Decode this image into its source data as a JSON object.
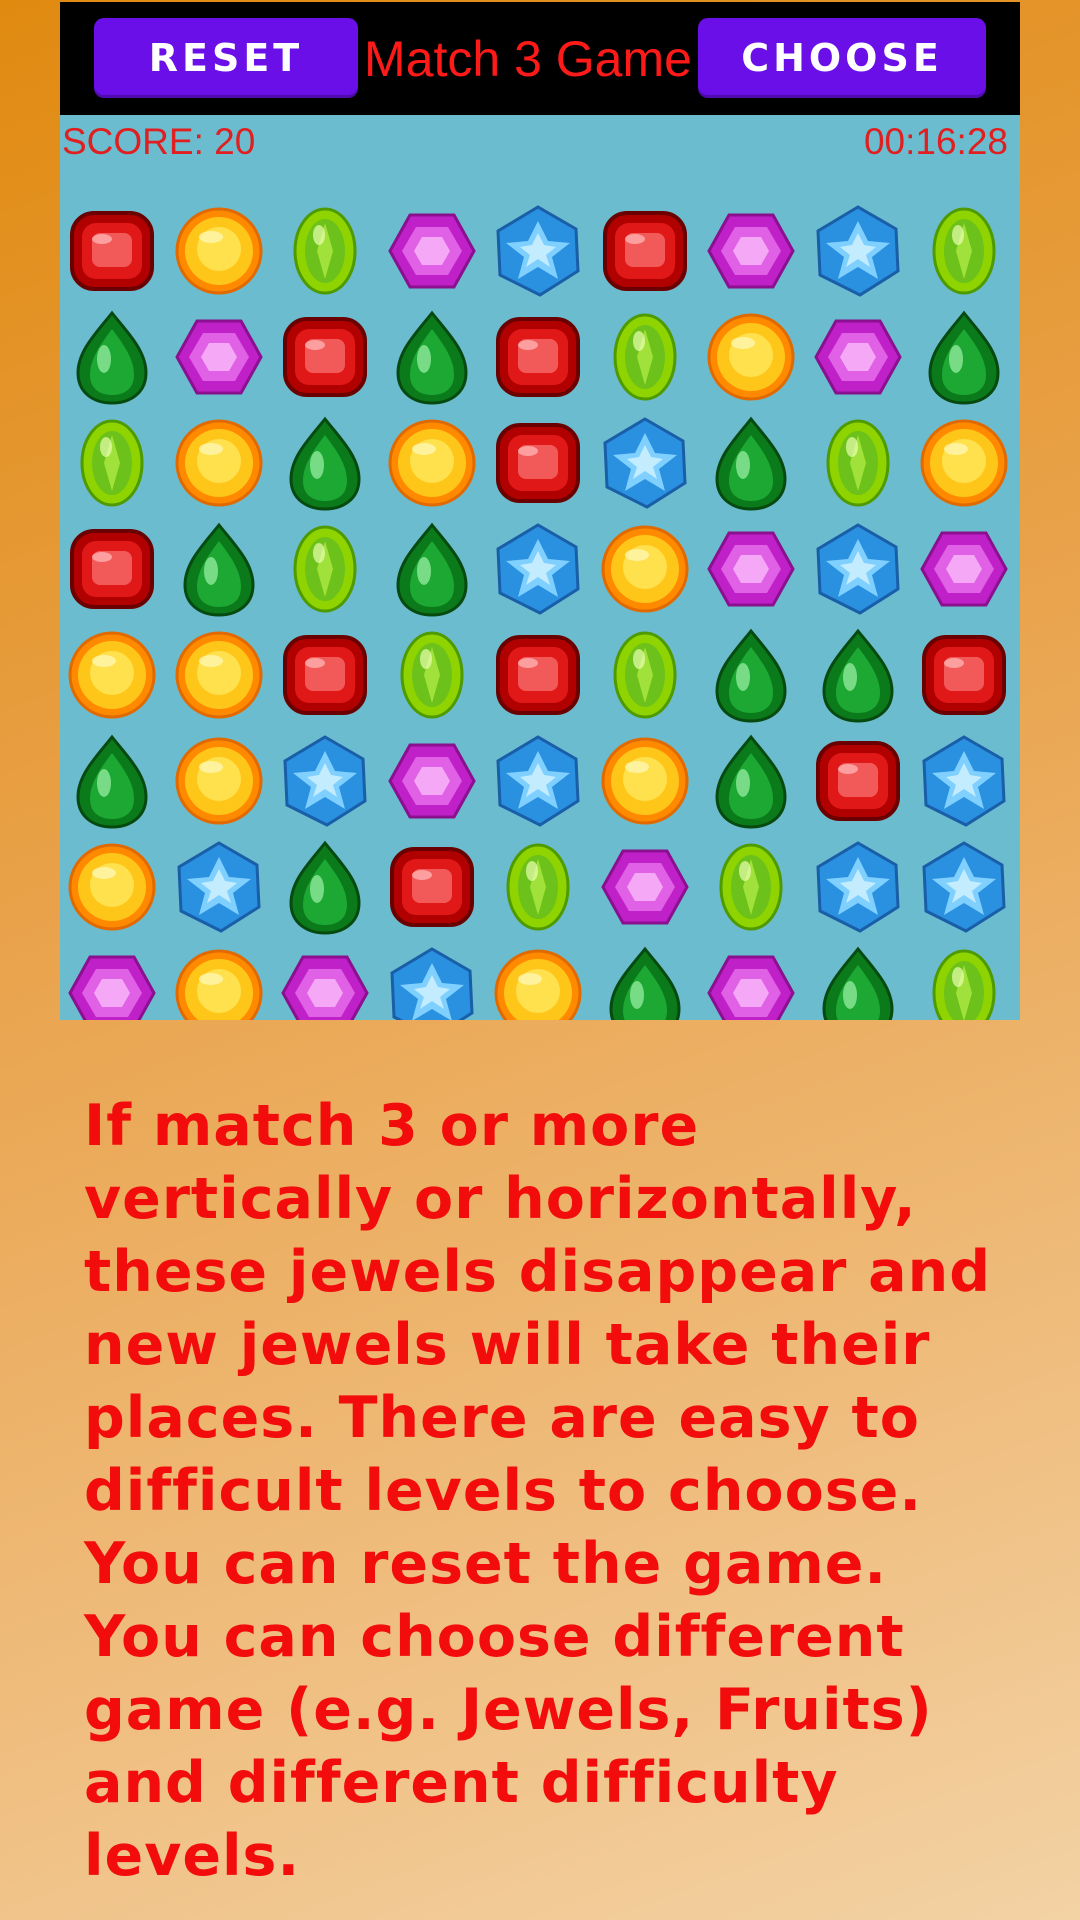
{
  "header": {
    "reset_label": "RESET",
    "title": "Match 3 Game",
    "choose_label": "CHOOSE"
  },
  "status": {
    "score": "SCORE: 20",
    "timer": "00:16:28"
  },
  "board": {
    "rows": [
      [
        "red-ruby",
        "yellow-sun",
        "lime-oval",
        "purple-hex",
        "blue-star",
        "red-ruby",
        "purple-hex",
        "blue-star",
        "lime-oval"
      ],
      [
        "green-drop",
        "purple-hex",
        "red-ruby",
        "green-drop",
        "red-ruby",
        "lime-oval",
        "yellow-sun",
        "purple-hex",
        "green-drop"
      ],
      [
        "lime-oval",
        "yellow-sun",
        "green-drop",
        "yellow-sun",
        "red-ruby",
        "blue-star",
        "green-drop",
        "lime-oval",
        "yellow-sun"
      ],
      [
        "red-ruby",
        "green-drop",
        "lime-oval",
        "green-drop",
        "blue-star",
        "yellow-sun",
        "purple-hex",
        "blue-star",
        "purple-hex"
      ],
      [
        "yellow-sun",
        "yellow-sun",
        "red-ruby",
        "lime-oval",
        "red-ruby",
        "lime-oval",
        "green-drop",
        "green-drop",
        "red-ruby"
      ],
      [
        "green-drop",
        "yellow-sun",
        "blue-star",
        "purple-hex",
        "blue-star",
        "yellow-sun",
        "green-drop",
        "red-ruby",
        "blue-star"
      ],
      [
        "yellow-sun",
        "blue-star",
        "green-drop",
        "red-ruby",
        "lime-oval",
        "purple-hex",
        "lime-oval",
        "blue-star",
        "blue-star"
      ],
      [
        "purple-hex",
        "yellow-sun",
        "purple-hex",
        "blue-star",
        "yellow-sun",
        "green-drop",
        "purple-hex",
        "green-drop",
        "lime-oval"
      ]
    ]
  },
  "colors": {
    "button": "#6a0fe8",
    "title": "#ff1a1a",
    "board_bg": "#6bbccf",
    "text": "#f20c0c"
  },
  "instructions": "If match 3 or more vertically or horizontally, these jewels disappear and new jewels will take their places. There are easy to difficult levels to choose. You can reset the game. You can choose different game (e.g. Jewels, Fruits) and different difficulty levels."
}
